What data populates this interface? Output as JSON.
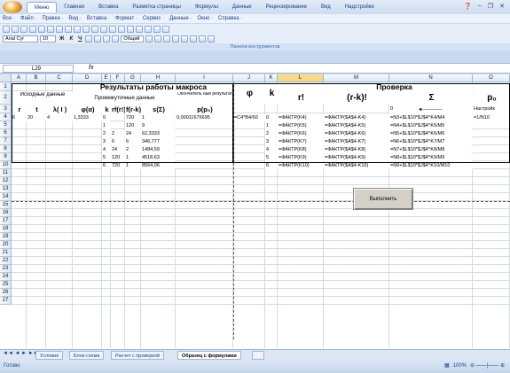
{
  "ribbon": {
    "tabs": [
      "Меню",
      "Главная",
      "Вставка",
      "Разметка страницы",
      "Формулы",
      "Данные",
      "Рецензирование",
      "Вид",
      "Надстройки"
    ],
    "active_index": 0
  },
  "menubar": [
    "Все ·",
    "Файл ·",
    "Правка ·",
    "Вид ·",
    "Вставка ·",
    "Формат ·",
    "Сервис ·",
    "Данные ·",
    "Окно ·",
    "Справка ·"
  ],
  "toolbar2": {
    "font": "Arial Cyr",
    "size": "10",
    "numfmt": "Общий",
    "bold": "Ж",
    "italic": "К",
    "underline": "Ч"
  },
  "panel_label": "Панели инструментов",
  "namebox": "L29",
  "fx": "fx",
  "columns": [
    "A",
    "B",
    "C",
    "D",
    "E",
    "F",
    "G",
    "H",
    "I",
    "J",
    "K",
    "L",
    "M",
    "N",
    "O"
  ],
  "rows": [
    "1",
    "2",
    "3",
    "4",
    "5",
    "6",
    "7",
    "8",
    "9",
    "10",
    "11",
    "12",
    "13",
    "14",
    "15",
    "16",
    "17",
    "18",
    "19",
    "20",
    "21",
    "22",
    "23",
    "24",
    "25",
    "26",
    "27"
  ],
  "headers": {
    "results_title": "Результаты работы макроса",
    "check_title": "Проверка",
    "input_data": "Исходные данные",
    "intermediate": "Промежуточные данные",
    "final": "Окончатель ный результат",
    "phi": "φ",
    "k": "k",
    "r_fact": "r!",
    "rk_fact": "(r-k)!",
    "sigma": "Σ",
    "p0": "p₀"
  },
  "row3": [
    "r",
    "t",
    "λ( I )",
    "φ(α)",
    "k",
    "rf(r!)",
    "f(r-k)!",
    "s(Σ)",
    "p(p₀)"
  ],
  "table_rows": [
    {
      "a": "6",
      "b": "20",
      "c": "4",
      "d": "1,3333",
      "e": "0",
      "f": "",
      "g": "720",
      "h": "1",
      "i": "0,00011676695",
      "j": "=C4*B4/60",
      "k": "0",
      "l": "=ФАКТР(K4)",
      "m": "=ФАКТР($A$4-K4)",
      "n": "=N3+$L$10*$J$4^K4/M4",
      "o": "=1/N10"
    },
    {
      "e": "1",
      "g": "120",
      "h": "9",
      "k": "1",
      "l": "=ФАКТР(K5)",
      "m": "=ФАКТР($A$4-K5)",
      "n": "=N4+$L$10*$J$4^K5/M5"
    },
    {
      "e": "2",
      "f": "2",
      "g": "24",
      "h": "62,3333",
      "k": "2",
      "l": "=ФАКТР(K6)",
      "m": "=ФАКТР($A$4-K6)",
      "n": "=N5+$L$10*$J$4^K6/M6"
    },
    {
      "e": "3",
      "f": "6",
      "g": "6",
      "h": "346,777",
      "k": "3",
      "l": "=ФАКТР(K7)",
      "m": "=ФАКТР($A$4-K7)",
      "n": "=N6+$L$10*$J$4^K7/M7"
    },
    {
      "e": "4",
      "f": "24",
      "g": "2",
      "h": "1484,59",
      "k": "4",
      "l": "=ФАКТР(K8)",
      "m": "=ФАКТР($A$4-K8)",
      "n": "=N7+$L$10*$J$4^K8/M8"
    },
    {
      "e": "5",
      "f": "120",
      "g": "1",
      "h": "4518,63",
      "k": "5",
      "l": "=ФАКТР(K9)",
      "m": "=ФАКТР($A$4-K9)",
      "n": "=N8+$L$10*$J$4^K9/M9"
    },
    {
      "e": "6",
      "f": "720",
      "g": "1",
      "h": "8564,06",
      "k": "6",
      "l": "=ФАКТР(K10)",
      "m": "=ФАКТР($A$4-K10)",
      "n": "=N9+$L$10*$J$4^K10/M10"
    }
  ],
  "row3_check": {
    "n": "0",
    "o": "Настройк"
  },
  "button_label": "Выполнить",
  "sheet_tabs": [
    "Условие",
    "Блок-схема",
    "Расчет с проверкой",
    "Образец с формулами"
  ],
  "active_sheet": 3,
  "status": "Готово",
  "zoom": "100%"
}
